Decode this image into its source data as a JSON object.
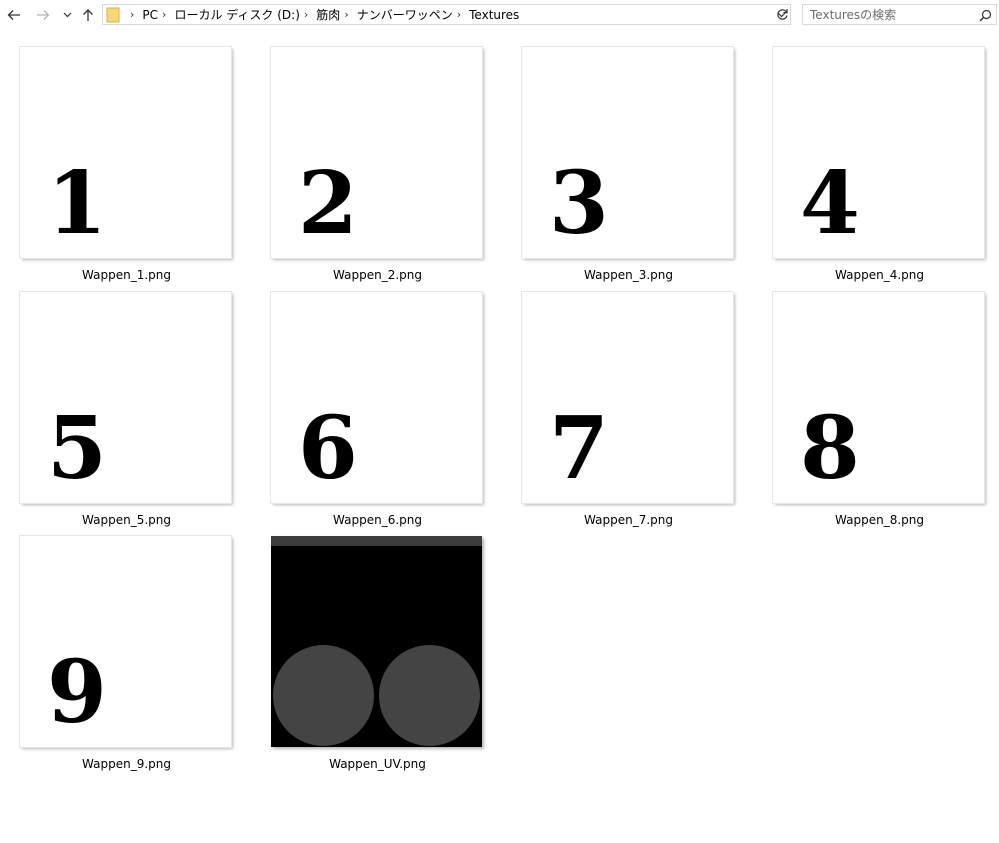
{
  "nav": {
    "back_icon": "arrow-left-icon",
    "forward_icon": "arrow-right-icon",
    "recent_icon": "chevron-down-icon",
    "up_icon": "arrow-up-icon"
  },
  "address_bar": {
    "crumbs": [
      "PC",
      "ローカル ディスク (D:)",
      "筋肉",
      "ナンバーワッペン",
      "Textures"
    ]
  },
  "search": {
    "placeholder": "Texturesの検索"
  },
  "files": [
    {
      "name": "Wappen_1.png",
      "numeral": "1"
    },
    {
      "name": "Wappen_2.png",
      "numeral": "2"
    },
    {
      "name": "Wappen_3.png",
      "numeral": "3"
    },
    {
      "name": "Wappen_4.png",
      "numeral": "4"
    },
    {
      "name": "Wappen_5.png",
      "numeral": "5"
    },
    {
      "name": "Wappen_6.png",
      "numeral": "6"
    },
    {
      "name": "Wappen_7.png",
      "numeral": "7"
    },
    {
      "name": "Wappen_8.png",
      "numeral": "8"
    },
    {
      "name": "Wappen_9.png",
      "numeral": "9"
    },
    {
      "name": "Wappen_UV.png",
      "numeral": ""
    }
  ],
  "colors": {
    "uv_background": "#000000",
    "uv_circles": "#444444",
    "uv_top_bar": "#3c3c3c"
  }
}
